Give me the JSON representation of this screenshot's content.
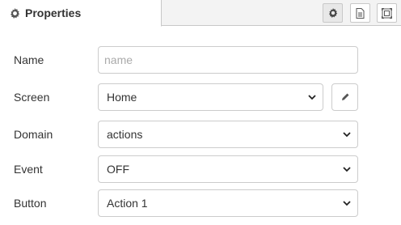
{
  "tab": {
    "label": "Properties",
    "icon": "gear-icon"
  },
  "toolbar": {
    "buttons": [
      {
        "icon": "gear-icon",
        "active": true
      },
      {
        "icon": "document-icon",
        "active": false
      },
      {
        "icon": "frame-icon",
        "active": false
      }
    ]
  },
  "form": {
    "name": {
      "label": "Name",
      "value": "",
      "placeholder": "name"
    },
    "screen": {
      "label": "Screen",
      "value": "Home"
    },
    "domain": {
      "label": "Domain",
      "value": "actions"
    },
    "event": {
      "label": "Event",
      "value": "OFF"
    },
    "button": {
      "label": "Button",
      "value": "Action 1"
    }
  },
  "colors": {
    "border": "#cccccc",
    "text": "#333333",
    "placeholder": "#aaaaaa",
    "tab_bar": "#f3f3f3"
  }
}
